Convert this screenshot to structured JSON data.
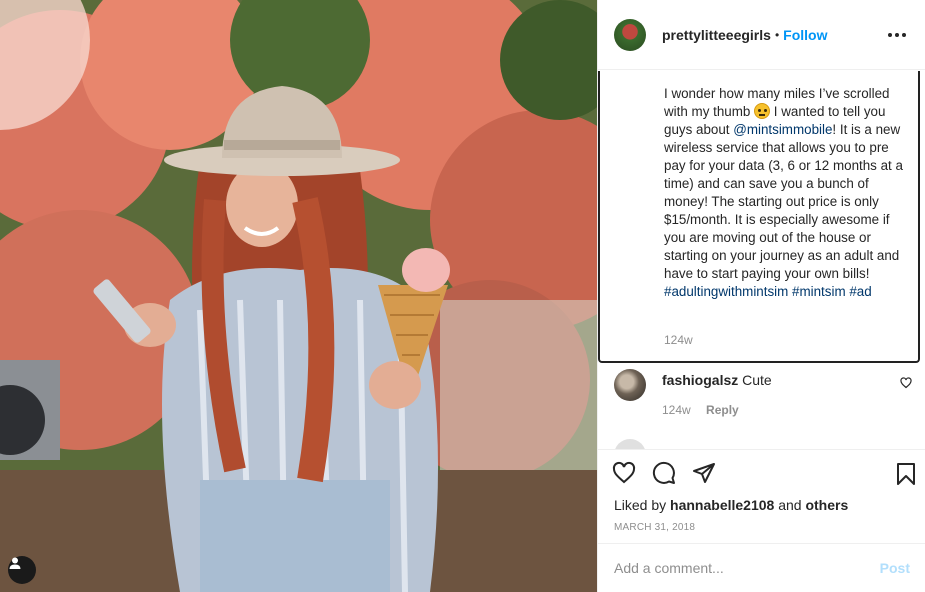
{
  "post": {
    "username": "prettylitteeegirls",
    "dot": "•",
    "follow_label": "Follow",
    "caption": {
      "text_before_emoji": "I wonder how many miles I’ve scrolled with my thumb",
      "emoji": "thinking-face-emoji",
      "text_a": " I wanted to tell you guys about ",
      "mention": "@mintsimmobile",
      "text_b": "! It is a new wireless service that allows you to pre pay for your data (3, 6 or 12 months at a time) and can save you a bunch of money! The starting out price is only $15/month. It is especially awesome if you are moving out of the house or starting on your journey as an adult and have to start paying your own bills! ",
      "hashtag1": "#adultingwithmintsim",
      "hashtag2": "#mintsim",
      "hashtag3": "#ad",
      "time": "124w"
    },
    "comments": [
      {
        "user": "fashiogalsz",
        "text": "Cute",
        "time": "124w",
        "reply_label": "Reply"
      }
    ],
    "liked_by_prefix": "Liked by ",
    "liked_by_user": "hannabelle2108",
    "liked_by_mid": " and ",
    "liked_by_others": "others",
    "date": "MARCH 31, 2018",
    "add_comment_placeholder": "Add a comment...",
    "post_label": "Post"
  },
  "colors": {
    "accent": "#0095f6",
    "link": "#00376b",
    "muted": "#8e8e8e",
    "post_disabled": "#b2dffc"
  }
}
